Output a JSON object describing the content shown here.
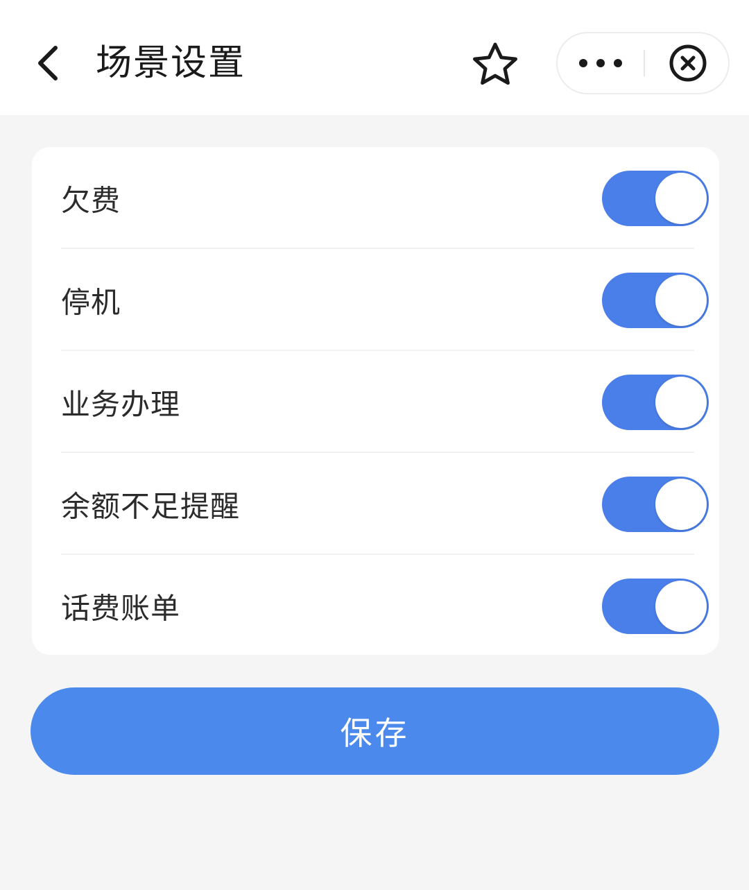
{
  "header": {
    "title": "场景设置",
    "back_icon": "chevron-left-icon",
    "star_icon": "star-outline-icon",
    "more_icon": "more-dots-icon",
    "close_icon": "close-circle-icon"
  },
  "settings": {
    "items": [
      {
        "label": "欠费",
        "enabled": true
      },
      {
        "label": "停机",
        "enabled": true
      },
      {
        "label": "业务办理",
        "enabled": true
      },
      {
        "label": "余额不足提醒",
        "enabled": true
      },
      {
        "label": "话费账单",
        "enabled": true
      }
    ]
  },
  "actions": {
    "save_label": "保存"
  },
  "colors": {
    "accent": "#4a7ee8",
    "button": "#4b8aec",
    "background": "#f5f5f5",
    "card": "#ffffff"
  }
}
